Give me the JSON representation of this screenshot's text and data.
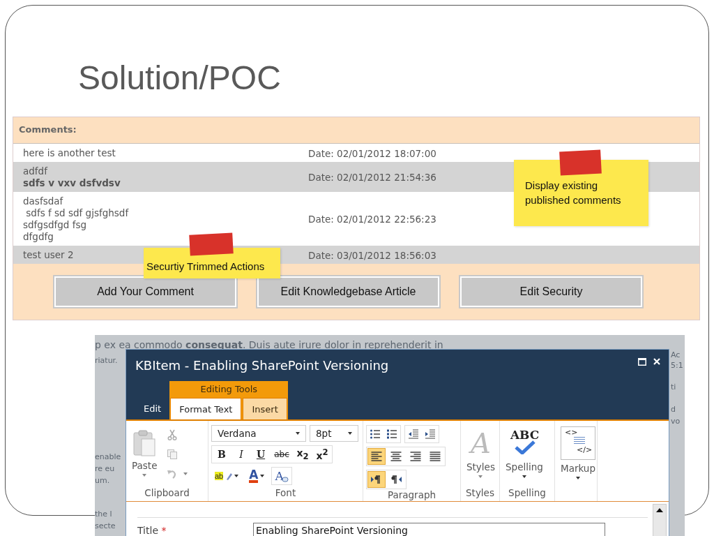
{
  "slide": {
    "title": "Solution/POC"
  },
  "comments": {
    "heading": "Comments:",
    "rows": [
      {
        "lines": [
          {
            "text": "here is another test",
            "bold": false
          }
        ],
        "date": "Date: 02/01/2012 18:07:00"
      },
      {
        "lines": [
          {
            "text": "adfdf",
            "bold": false
          },
          {
            "text": "sdfs v vxv dsfvdsv",
            "bold": true
          }
        ],
        "date": "Date: 02/01/2012 21:54:36"
      },
      {
        "lines": [
          {
            "text": "dasfsdaf",
            "bold": false
          },
          {
            "text": " sdfs f sd sdf gjsfghsdf",
            "bold": false
          },
          {
            "text": "sdfgsdfgd fsg",
            "bold": false
          },
          {
            "text": "dfgdfg",
            "bold": false
          }
        ],
        "date": "Date: 02/01/2012 22:56:23"
      },
      {
        "lines": [
          {
            "text": "test user 2",
            "bold": false
          }
        ],
        "date": "Date: 03/01/2012 18:56:03"
      }
    ],
    "buttons": [
      "Add Your Comment",
      "Edit Knowledgebase Article",
      "Edit Security"
    ]
  },
  "notes": [
    {
      "text": "Display existing published comments"
    },
    {
      "text": "Securtiy Trimmed Actions"
    }
  ],
  "background_text": {
    "top": [
      "p ex ea commodo **consequat**. Duis aute irure dolor in reprehenderit in"
    ],
    "left": [
      "riatur.",
      "enable",
      "re eu",
      "um.",
      "the l",
      "secte"
    ],
    "right": [
      "Ac",
      "5:1",
      "ti",
      "d",
      "vo"
    ]
  },
  "dialog": {
    "title": "KBItem - Enabling SharePoint Versioning",
    "context_label": "Editing Tools",
    "tabs": [
      {
        "label": "Edit",
        "selected": false,
        "contextual": false
      },
      {
        "label": "Format Text",
        "selected": true,
        "contextual": true
      },
      {
        "label": "Insert",
        "selected": false,
        "contextual": true
      }
    ],
    "ribbon": {
      "clipboard": {
        "paste": "Paste",
        "group": "Clipboard"
      },
      "font": {
        "face": "Verdana",
        "size": "8pt",
        "styles": [
          "B",
          "I",
          "U",
          "abc",
          "x$_{2}$",
          "x$^{2}$"
        ],
        "highlight_text": "ab",
        "color_text": "A",
        "clear_text": "A",
        "group": "Font"
      },
      "paragraph": {
        "align": [
          {
            "selected": true
          },
          {
            "selected": false
          },
          {
            "selected": false
          },
          {
            "selected": false
          }
        ],
        "direction": [
          {
            "selected": true
          },
          {
            "selected": false
          }
        ],
        "group": "Paragraph"
      },
      "styles": {
        "label": "Styles",
        "icon_text": "A",
        "group": "Styles"
      },
      "spelling": {
        "label": "Spelling",
        "icon_text": "ABC",
        "group": "Spelling"
      },
      "markup": {
        "label": "Markup",
        "icon_text": [
          "<>",
          "</>"
        ]
      }
    },
    "form": {
      "fields": [
        {
          "label": "Title",
          "required_mark": "*",
          "value": "Enabling SharePoint Versioning"
        }
      ]
    }
  }
}
